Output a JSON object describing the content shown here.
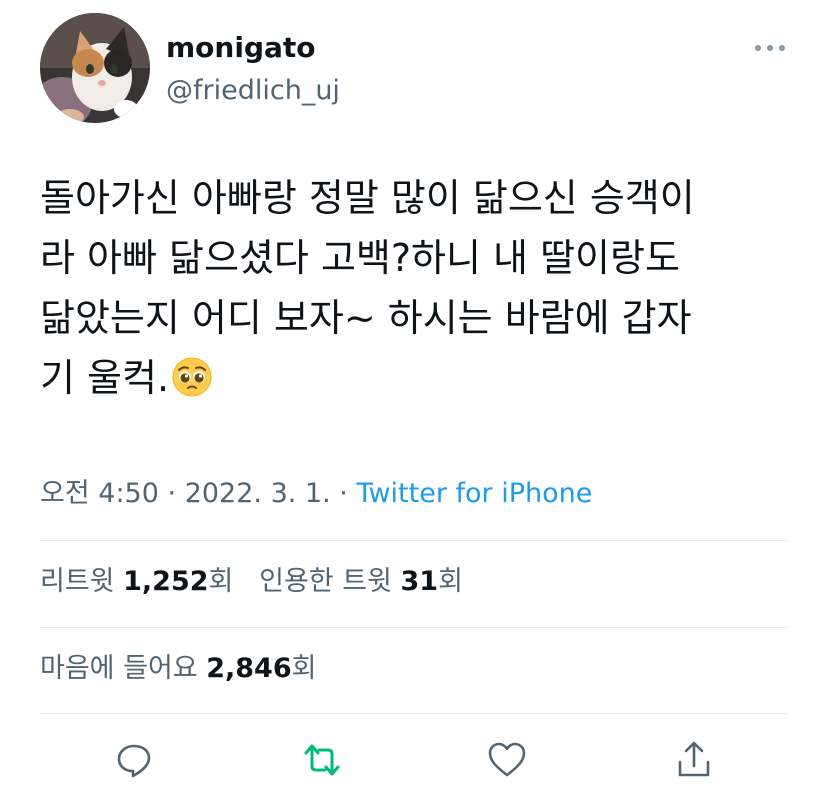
{
  "tweet": {
    "author": {
      "display_name": "monigato",
      "handle": "@friedlich_uj",
      "avatar_icon": "cat-avatar-icon"
    },
    "text_lines": [
      "돌아가신 아빠랑 정말 많이 닮으신 승객이",
      "라 아빠 닮으셨다 고백?하니 내 딸이랑도",
      "닮았는지 어디 보자~ 하시는 바람에 갑자",
      "기 울컥."
    ],
    "emoji": "pleading-face-emoji",
    "timestamp": {
      "time": "오전 4:50",
      "separator": "·",
      "date": "2022. 3. 1.",
      "source": "Twitter for iPhone"
    },
    "stats": {
      "retweets_label": "리트윗",
      "retweets_count": "1,252",
      "retweets_unit": "회",
      "quotes_label": "인용한 트윗",
      "quotes_count": "31",
      "quotes_unit": "회",
      "likes_label": "마음에 들어요",
      "likes_count": "2,846",
      "likes_unit": "회"
    },
    "actions": [
      "reply-icon",
      "retweet-icon",
      "like-icon",
      "share-icon"
    ]
  },
  "colors": {
    "text_primary": "#0f1419",
    "text_secondary": "#536471",
    "link": "#1d9bf0",
    "retweet_green": "#00ba7c",
    "divider": "#e4e8eb"
  }
}
